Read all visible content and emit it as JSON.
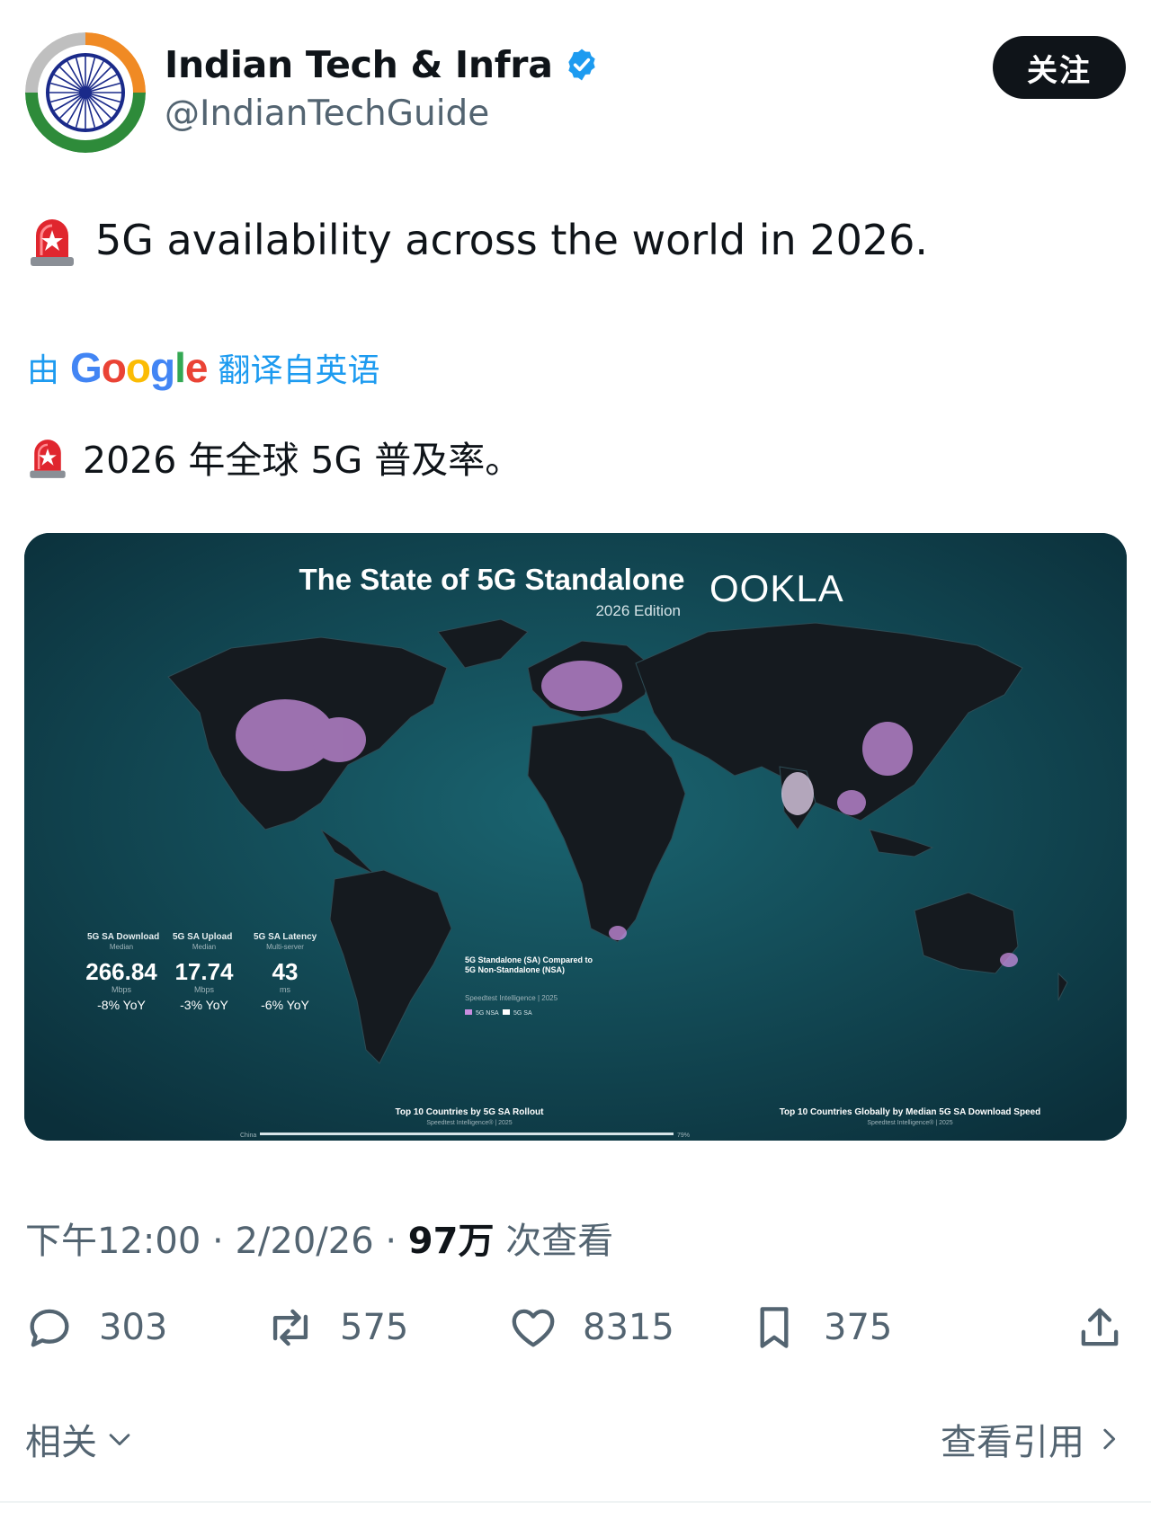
{
  "account": {
    "name": "Indian Tech & Infra",
    "handle": "@IndianTechGuide",
    "follow_label": "关注"
  },
  "tweet": {
    "text": "5G availability across the world in 2026.",
    "translate_prefix": "由",
    "translate_brand": "Google",
    "translate_suffix": "翻译自英语",
    "translated_text": "2026 年全球 5G 普及率。"
  },
  "media": {
    "title": "The State of 5G Standalone",
    "edition": "2026 Edition",
    "brand": "OOKLA",
    "stats": [
      {
        "label": "5G SA Download",
        "sub": "Median",
        "value": "266.84",
        "unit": "Mbps",
        "change": "-8% YoY"
      },
      {
        "label": "5G SA Upload",
        "sub": "Median",
        "value": "17.74",
        "unit": "Mbps",
        "change": "-3% YoY"
      },
      {
        "label": "5G SA Latency",
        "sub": "Multi-server",
        "value": "43",
        "unit": "ms",
        "change": "-6% YoY"
      }
    ],
    "legend_title": "5G Standalone (SA) Compared to 5G Non-Standalone (NSA)",
    "legend_source": "Speedtest Intelligence | 2025",
    "legend_items": [
      "5G NSA",
      "5G SA"
    ],
    "bottom_left_title": "Top 10 Countries by 5G SA Rollout",
    "bottom_left_source": "Speedtest Intelligence® | 2025",
    "bottom_right_title": "Top 10 Countries Globally by Median 5G SA Download Speed",
    "bottom_right_source": "Speedtest Intelligence® | 2025",
    "bar_country": "China",
    "bar_value": "79%"
  },
  "meta": {
    "time": "下午12:00",
    "sep": "·",
    "date": "2/20/26",
    "views_count": "97万",
    "views_label": "次查看"
  },
  "actions": {
    "replies": "303",
    "reposts": "575",
    "likes": "8315",
    "bookmarks": "375"
  },
  "footer": {
    "related_label": "相关",
    "quotes_label": "查看引用"
  },
  "colors": {
    "accent": "#1d9bf0",
    "map_bg": "#0e3d4a",
    "highlight": "#c98ee0"
  }
}
